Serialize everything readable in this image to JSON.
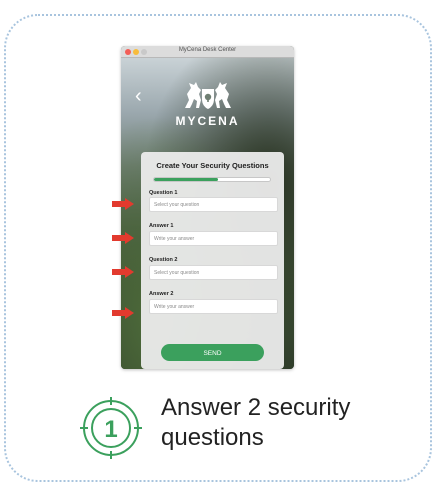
{
  "window": {
    "title": "MyCena Desk Center",
    "traffic_colors": [
      "#f35e57",
      "#f8bc3c",
      "#c9c9c9"
    ]
  },
  "brand": {
    "name": "MYCENA"
  },
  "form": {
    "title": "Create Your Security Questions",
    "progress": 0.55,
    "fields": [
      {
        "label": "Question 1",
        "placeholder": "Select your question"
      },
      {
        "label": "Answer 1",
        "placeholder": "Write your answer"
      },
      {
        "label": "Question 2",
        "placeholder": "Select your question"
      },
      {
        "label": "Answer 2",
        "placeholder": "Write your answer"
      }
    ],
    "send_label": "SEND"
  },
  "step": {
    "number": "1",
    "text": "Answer 2 security questions"
  },
  "colors": {
    "accent_green": "#3ba05d",
    "arrow_red": "#e23a2e",
    "border_blue": "#a8c4de"
  }
}
